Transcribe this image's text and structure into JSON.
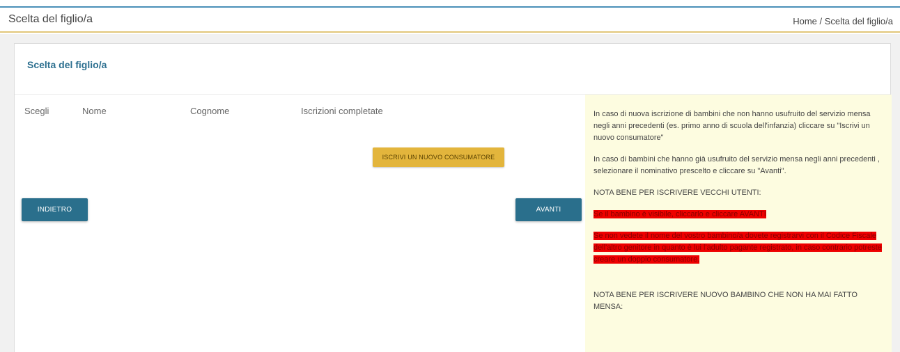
{
  "header": {
    "page_title": "Scelta del figlio/a",
    "breadcrumb": "Home / Scelta del figlio/a"
  },
  "panel": {
    "title": "Scelta del figlio/a",
    "table": {
      "columns": [
        "Scegli",
        "Nome",
        "Cognome",
        "Iscrizioni completate"
      ]
    },
    "buttons": {
      "new_consumer": "ISCRIVI UN NUOVO CONSUMATORE",
      "back": "INDIETRO",
      "next": "AVANTI"
    }
  },
  "info": {
    "para1": "In caso di nuova iscrizione di bambini che non hanno usufruito del servizio mensa negli anni precedenti (es. primo anno di scuola dell'infanzia) cliccare su \"Iscrivi un nuovo consumatore\"",
    "para2": "In caso di  bambini che hanno già usufruito del servizio mensa negli anni precedenti , selezionare il nominativo prescelto e cliccare su \"Avanti\".",
    "note_old_heading": "NOTA BENE PER ISCRIVERE VECCHI UTENTI:",
    "red1": "Se il bambino è visibile, cliccarlo e cliccare AVANTI",
    "red2": "Se non vedete il nome del vostro bambino/a dovete registrarvi con il Codice Fiscale dell'altro genitore in quanto è lui l'adulto pagante registrato, in caso contrario potreste creare un doppio consumatore.",
    "note_new_heading": "NOTA BENE PER ISCRIVERE NUOVO BAMBINO CHE NON HA MAI FATTO MENSA:"
  },
  "colors": {
    "accent_blue": "#2a6f8c",
    "button_yellow": "#e3b53c",
    "note_bg": "#fdfce0",
    "warning_red": "#ee0000"
  }
}
